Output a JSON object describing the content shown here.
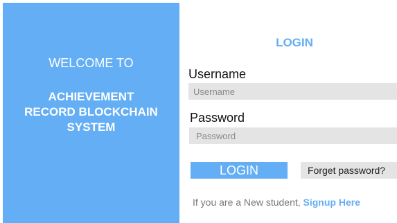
{
  "welcome": {
    "greeting": "WELCOME TO",
    "system_name_lines": [
      "ACHIEVEMENT",
      "RECORD BLOCKCHAIN",
      "SYSTEM"
    ]
  },
  "login_form": {
    "title": "LOGIN",
    "username_label": "Username",
    "username_placeholder": "Username",
    "username_value": "",
    "password_label": "Password",
    "password_placeholder": "Password",
    "password_value": "",
    "login_button_label": "LOGIN",
    "forget_password_label": "Forget password?",
    "new_student_text": "If you are a New student,",
    "signup_link_label": "Signup Here"
  },
  "colors": {
    "accent": "#64aef5",
    "input_background": "#e4e4e4",
    "panel_text": "#ffffff"
  }
}
